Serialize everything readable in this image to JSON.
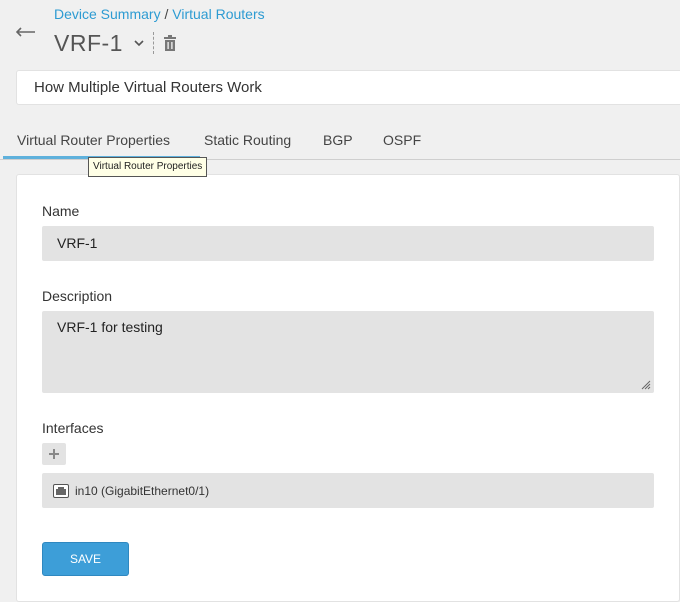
{
  "breadcrumb": {
    "parent": "Device Summary",
    "separator": " / ",
    "current": "Virtual Routers"
  },
  "header": {
    "title": "VRF-1",
    "back_icon": "back-arrow-icon",
    "dropdown_icon": "chevron-down-icon",
    "delete_icon": "trash-icon"
  },
  "help": {
    "text": "How Multiple Virtual Routers Work"
  },
  "tabs": [
    {
      "label": "Virtual Router Properties",
      "active": true
    },
    {
      "label": "Static Routing",
      "active": false
    },
    {
      "label": "BGP",
      "active": false
    },
    {
      "label": "OSPF",
      "active": false
    }
  ],
  "tooltip": {
    "text": "Virtual Router Properties"
  },
  "form": {
    "name_label": "Name",
    "name_value": "VRF-1",
    "description_label": "Description",
    "description_value": "VRF-1 for testing",
    "interfaces_label": "Interfaces",
    "add_icon": "plus-icon",
    "interfaces": [
      {
        "icon": "interface-icon",
        "label": "in10 (GigabitEthernet0/1)"
      }
    ],
    "save_label": "SAVE"
  },
  "colors": {
    "accent": "#2d9bd2",
    "save_button": "#3d9ed8",
    "active_tab_underline": "#5fb1dc",
    "field_background": "#e3e3e3"
  }
}
